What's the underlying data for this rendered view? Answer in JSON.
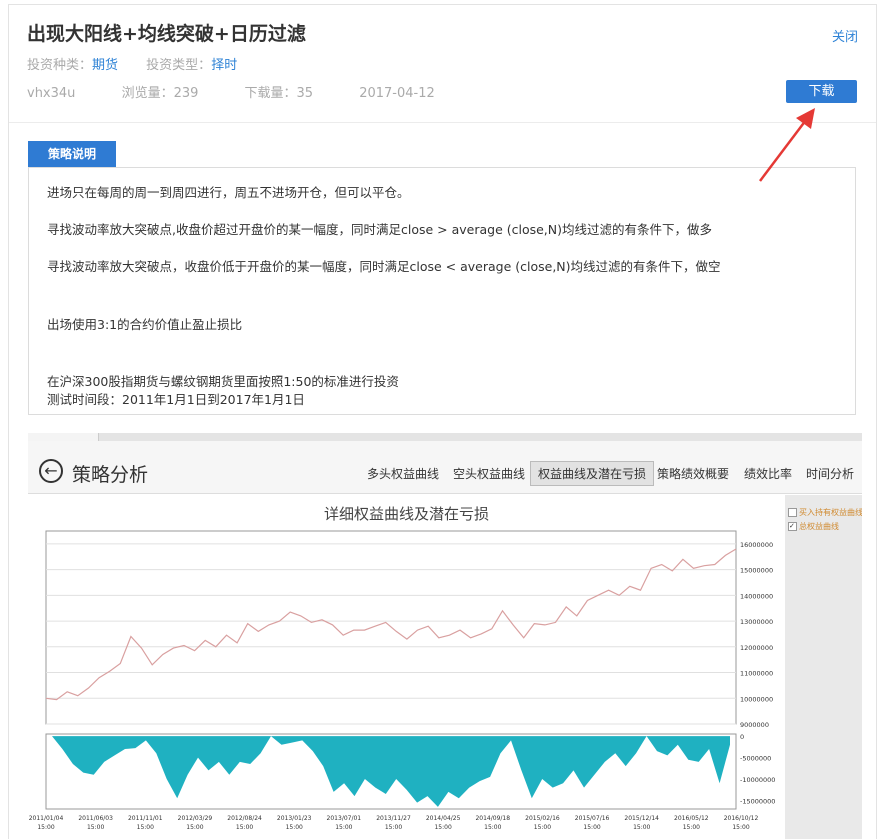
{
  "header": {
    "title": "出现大阳线+均线突破+日历过滤",
    "close_label": "关闭",
    "invest_kind_label": "投资种类：",
    "invest_kind_value": "期货",
    "invest_type_label": "投资类型：",
    "invest_type_value": "择时",
    "author": "vhx34u",
    "views": "浏览量：239",
    "downloads": "下载量：35",
    "date": "2017-04-12",
    "download_label": "下载"
  },
  "strategy": {
    "tab_label": "策略说明",
    "lines": [
      "进场只在每周的周一到周四进行，周五不进场开仓，但可以平仓。",
      "寻找波动率放大突破点,收盘价超过开盘价的某一幅度，同时满足close > average (close,N)均线过滤的有条件下，做多",
      "寻找波动率放大突破点，收盘价低于开盘价的某一幅度，同时满足close < average (close,N)均线过滤的有条件下，做空",
      "出场使用3:1的合约价值止盈止损比",
      "在沪深300股指期货与螺纹钢期货里面按照1:50的标准进行投资",
      "测试时间段：2011年1月1日到2017年1月1日"
    ]
  },
  "analysis": {
    "title": "策略分析",
    "tabs": [
      "多头权益曲线",
      "空头权益曲线",
      "权益曲线及潜在亏损",
      "策略绩效概要",
      "绩效比率",
      "时间分析"
    ],
    "active_tab": "权益曲线及潜在亏损",
    "legend": [
      "买入持有权益曲线",
      "总权益曲线"
    ]
  },
  "colors": {
    "accent": "#2f7bd3",
    "link": "#2f83d6",
    "arrow": "#e53935",
    "equity_line": "#d9a0a0",
    "drawdown_fill": "#1fb1c1"
  },
  "chart_data": {
    "type": "line",
    "title": "详细权益曲线及潜在亏损",
    "x": [
      "2011/01/04 15:00",
      "2011/06/03 15:00",
      "2011/11/01 15:00",
      "2012/03/29 15:00",
      "2012/08/24 15:00",
      "2013/01/23 15:00",
      "2013/07/01 15:00",
      "2013/11/27 15:00",
      "2014/04/25 15:00",
      "2014/09/18 15:00",
      "2015/02/16 15:00",
      "2015/07/16 15:00",
      "2015/12/14 15:00",
      "2016/05/12 15:00",
      "2016/10/12 15:00"
    ],
    "equity": {
      "ylim": [
        9000000,
        16500000
      ],
      "yticks": [
        "16000000",
        "15000000",
        "14000000",
        "13000000",
        "12000000",
        "11000000",
        "10000000",
        "9000000"
      ],
      "tick_values": [
        16000000,
        15000000,
        14000000,
        13000000,
        12000000,
        11000000,
        10000000,
        9000000
      ],
      "values": [
        10000000,
        9950000,
        10250000,
        10100000,
        10400000,
        10800000,
        11050000,
        11350000,
        12400000,
        11950000,
        11300000,
        11700000,
        11950000,
        12050000,
        11850000,
        12250000,
        12000000,
        12450000,
        12150000,
        12900000,
        12600000,
        12850000,
        13000000,
        13350000,
        13200000,
        12950000,
        13050000,
        12850000,
        12450000,
        12650000,
        12650000,
        12800000,
        12950000,
        12600000,
        12300000,
        12650000,
        12800000,
        12350000,
        12450000,
        12650000,
        12350000,
        12500000,
        12700000,
        13400000,
        12850000,
        12350000,
        12900000,
        12850000,
        12950000,
        13550000,
        13200000,
        13800000,
        14000000,
        14200000,
        14000000,
        14350000,
        14200000,
        15050000,
        15200000,
        14950000,
        15400000,
        15050000,
        15150000,
        15200000,
        15550000,
        15800000
      ]
    },
    "drawdown": {
      "ylim": [
        -17000000,
        500000
      ],
      "yticks": [
        "0",
        "-5000000",
        "-10000000",
        "-15000000"
      ],
      "tick_values": [
        0,
        -5000000,
        -10000000,
        -15000000
      ],
      "values": [
        0,
        -3000000,
        -6500000,
        -8500000,
        -9000000,
        -6000000,
        -4500000,
        -3000000,
        -2800000,
        -1000000,
        -4000000,
        -10000000,
        -14500000,
        -9000000,
        -5000000,
        -8000000,
        -6000000,
        -9000000,
        -6000000,
        -6500000,
        -4000000,
        0,
        -2000000,
        -1500000,
        -1000000,
        -3500000,
        -7000000,
        -13000000,
        -11000000,
        -14000000,
        -10000000,
        -12000000,
        -13500000,
        -10000000,
        -12500000,
        -15500000,
        -14000000,
        -16500000,
        -13000000,
        -14500000,
        -12000000,
        -10500000,
        -9500000,
        -4000000,
        -1000000,
        -8000000,
        -14500000,
        -10000000,
        -12000000,
        -11000000,
        -8000000,
        -12000000,
        -9000000,
        -6000000,
        -4000000,
        -7000000,
        -4000000,
        0,
        -3500000,
        -4500000,
        -2000000,
        -5500000,
        -6000000,
        -3000000,
        -11000000,
        -2000000
      ]
    }
  }
}
